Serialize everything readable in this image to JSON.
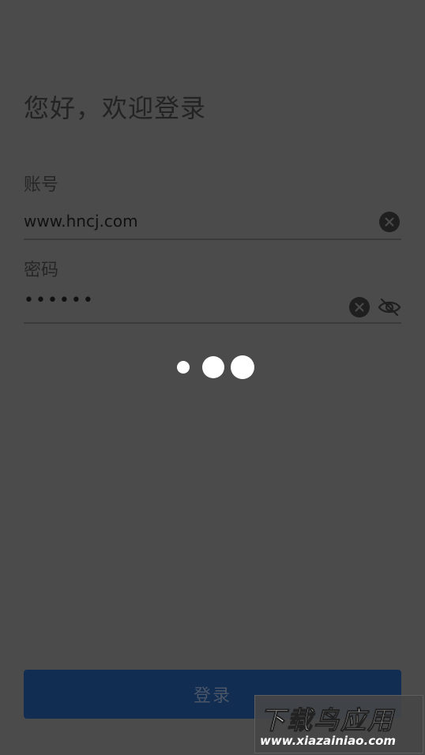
{
  "header": {
    "welcome_text": "您好，欢迎登录"
  },
  "account": {
    "label": "账号",
    "value": "www.hncj.com"
  },
  "password": {
    "label": "密码",
    "value": "••••••"
  },
  "icons": {
    "clear_account": "clear-circle-icon",
    "clear_password": "clear-circle-icon",
    "visibility": "eye-off-icon"
  },
  "loading": {
    "state": "loading"
  },
  "login_button": {
    "label": "登录"
  },
  "watermark": {
    "line1": "下载鸟应用",
    "line2": "www.xiazainiao.com"
  },
  "colors": {
    "background": "#4b4b4b",
    "button": "#112e52",
    "button_text": "#4a5568"
  }
}
